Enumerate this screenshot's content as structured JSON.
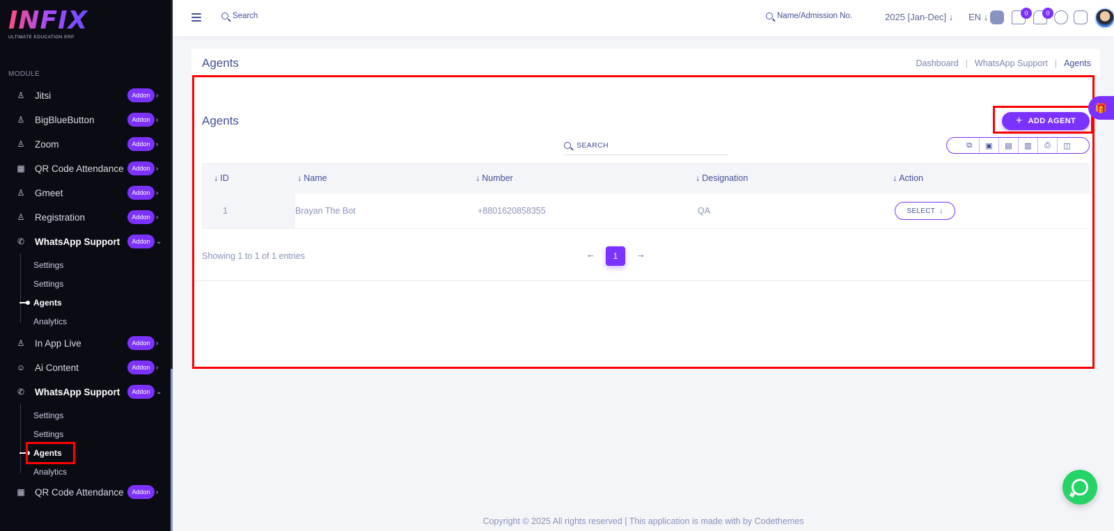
{
  "sidebar": {
    "brand": "INFIX",
    "tagline": "ULTIMATE EDUCATION ERP",
    "module_label": "MODULE",
    "addon_label": "Addon",
    "items": [
      {
        "label": "Jitsi",
        "icon": "person-icon"
      },
      {
        "label": "BigBlueButton",
        "icon": "person-icon"
      },
      {
        "label": "Zoom",
        "icon": "person-icon"
      },
      {
        "label": "QR Code Attendance",
        "icon": "qr-grid-icon"
      },
      {
        "label": "Gmeet",
        "icon": "person-icon"
      },
      {
        "label": "Registration",
        "icon": "person-icon"
      },
      {
        "label": "WhatsApp Support",
        "icon": "whatsapp-icon"
      },
      {
        "label": "In App Live",
        "icon": "person-icon"
      },
      {
        "label": "Ai Content",
        "icon": "robot-icon"
      },
      {
        "label": "WhatsApp Support",
        "icon": "whatsapp-icon"
      },
      {
        "label": "QR Code Attendance",
        "icon": "qr-grid-icon"
      }
    ],
    "sub1": [
      "Settings",
      "Settings",
      "Agents",
      "Analytics"
    ],
    "sub2": [
      "Settings",
      "Settings",
      "Agents",
      "Analytics"
    ]
  },
  "topbar": {
    "search_label": "Search",
    "name_search_label": "Name/Admission No.",
    "session": "2025 [Jan-Dec]",
    "language": "EN",
    "chat_count": "0",
    "notification_count": "0"
  },
  "page": {
    "title": "Agents",
    "breadcrumbs": [
      "Dashboard",
      "WhatsApp Support",
      "Agents"
    ]
  },
  "card": {
    "title": "Agents",
    "add_button": "ADD AGENT",
    "search_placeholder": "SEARCH",
    "columns": [
      "ID",
      "Name",
      "Number",
      "Designation",
      "Action"
    ],
    "rows": [
      {
        "id": "1",
        "name": "Brayan The Bot",
        "number": "+8801620858355",
        "designation": "QA",
        "action": "SELECT"
      }
    ],
    "showing": "Showing 1 to 1 of 1 entries",
    "current_page": "1"
  },
  "footer": "Copyright © 2025 All rights reserved | This application is made with by Codethemes",
  "colors": {
    "accent": "#7c32ff",
    "text": "#415094",
    "sidebar_bg": "#0b0b14",
    "highlight": "#ff0000"
  }
}
